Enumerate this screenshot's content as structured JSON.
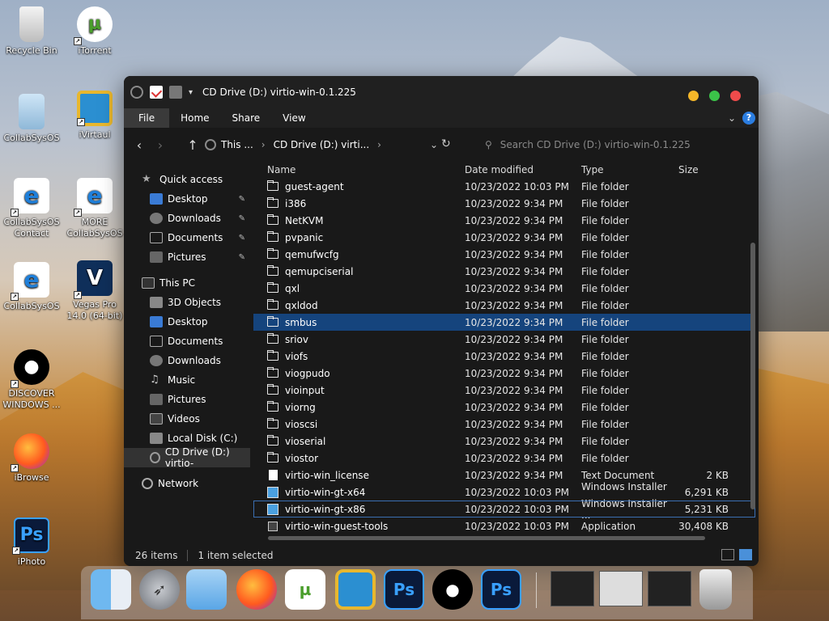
{
  "desktop": {
    "icons": [
      {
        "label": "Recycle Bin",
        "icon": "recycle-bin-icon"
      },
      {
        "label": "iTorrent",
        "icon": "utorrent-icon"
      },
      {
        "label": "CollabSysOS",
        "icon": "folder-icon"
      },
      {
        "label": "iVirtaul",
        "icon": "virtual-icon"
      },
      {
        "label": "CollabSysOS Contact",
        "icon": "ie-icon"
      },
      {
        "label": "MORE CollabSysOS",
        "icon": "ie-icon"
      },
      {
        "label": "CollabSysOS",
        "icon": "ie-icon"
      },
      {
        "label": "Vegas Pro 14.0 (64-bit)",
        "icon": "vegas-icon"
      },
      {
        "label": "DISCOVER WINDOWS ...",
        "icon": "apple-icon"
      },
      {
        "label": "iBrowse",
        "icon": "firefox-icon"
      },
      {
        "label": "iPhoto",
        "icon": "photoshop-icon"
      }
    ]
  },
  "window": {
    "title": "CD Drive (D:) virtio-win-0.1.225",
    "ribbon_tabs": [
      "File",
      "Home",
      "Share",
      "View"
    ],
    "help_label": "?",
    "address": {
      "crumbs": [
        "This ...",
        "CD Drive (D:) virti..."
      ],
      "search_placeholder": "Search CD Drive (D:) virtio-win-0.1.225"
    },
    "nav": {
      "quick_access": "Quick access",
      "quick_items": [
        "Desktop",
        "Downloads",
        "Documents",
        "Pictures"
      ],
      "this_pc": "This PC",
      "pc_items": [
        "3D Objects",
        "Desktop",
        "Documents",
        "Downloads",
        "Music",
        "Pictures",
        "Videos",
        "Local Disk (C:)",
        "CD Drive (D:) virtio-"
      ],
      "network": "Network"
    },
    "columns": {
      "name": "Name",
      "date": "Date modified",
      "type": "Type",
      "size": "Size"
    },
    "rows": [
      {
        "name": "guest-agent",
        "date": "10/23/2022 10:03 PM",
        "type": "File folder",
        "size": "",
        "kind": "folder"
      },
      {
        "name": "i386",
        "date": "10/23/2022 9:34 PM",
        "type": "File folder",
        "size": "",
        "kind": "folder"
      },
      {
        "name": "NetKVM",
        "date": "10/23/2022 9:34 PM",
        "type": "File folder",
        "size": "",
        "kind": "folder"
      },
      {
        "name": "pvpanic",
        "date": "10/23/2022 9:34 PM",
        "type": "File folder",
        "size": "",
        "kind": "folder"
      },
      {
        "name": "qemufwcfg",
        "date": "10/23/2022 9:34 PM",
        "type": "File folder",
        "size": "",
        "kind": "folder"
      },
      {
        "name": "qemupciserial",
        "date": "10/23/2022 9:34 PM",
        "type": "File folder",
        "size": "",
        "kind": "folder"
      },
      {
        "name": "qxl",
        "date": "10/23/2022 9:34 PM",
        "type": "File folder",
        "size": "",
        "kind": "folder"
      },
      {
        "name": "qxldod",
        "date": "10/23/2022 9:34 PM",
        "type": "File folder",
        "size": "",
        "kind": "folder"
      },
      {
        "name": "smbus",
        "date": "10/23/2022 9:34 PM",
        "type": "File folder",
        "size": "",
        "kind": "folder"
      },
      {
        "name": "sriov",
        "date": "10/23/2022 9:34 PM",
        "type": "File folder",
        "size": "",
        "kind": "folder"
      },
      {
        "name": "viofs",
        "date": "10/23/2022 9:34 PM",
        "type": "File folder",
        "size": "",
        "kind": "folder"
      },
      {
        "name": "viogpudo",
        "date": "10/23/2022 9:34 PM",
        "type": "File folder",
        "size": "",
        "kind": "folder"
      },
      {
        "name": "vioinput",
        "date": "10/23/2022 9:34 PM",
        "type": "File folder",
        "size": "",
        "kind": "folder"
      },
      {
        "name": "viorng",
        "date": "10/23/2022 9:34 PM",
        "type": "File folder",
        "size": "",
        "kind": "folder"
      },
      {
        "name": "vioscsi",
        "date": "10/23/2022 9:34 PM",
        "type": "File folder",
        "size": "",
        "kind": "folder"
      },
      {
        "name": "vioserial",
        "date": "10/23/2022 9:34 PM",
        "type": "File folder",
        "size": "",
        "kind": "folder"
      },
      {
        "name": "viostor",
        "date": "10/23/2022 9:34 PM",
        "type": "File folder",
        "size": "",
        "kind": "folder"
      },
      {
        "name": "virtio-win_license",
        "date": "10/23/2022 9:34 PM",
        "type": "Text Document",
        "size": "2 KB",
        "kind": "text"
      },
      {
        "name": "virtio-win-gt-x64",
        "date": "10/23/2022 10:03 PM",
        "type": "Windows Installer ...",
        "size": "6,291 KB",
        "kind": "msi"
      },
      {
        "name": "virtio-win-gt-x86",
        "date": "10/23/2022 10:03 PM",
        "type": "Windows Installer ...",
        "size": "5,231 KB",
        "kind": "msi"
      },
      {
        "name": "virtio-win-guest-tools",
        "date": "10/23/2022 10:03 PM",
        "type": "Application",
        "size": "30,408 KB",
        "kind": "app"
      }
    ],
    "selected_row": "smbus",
    "status": {
      "items": "26 items",
      "selected": "1 item selected"
    }
  },
  "dock": {
    "apps": [
      "Finder",
      "Launchpad",
      "Folder",
      "Firefox",
      "uTorrent",
      "iVirtual",
      "Photoshop",
      "Apple",
      "Photoshop"
    ]
  },
  "colors": {
    "window_bg": "#191919",
    "selection": "#15447d",
    "accent": "#2b7de0"
  }
}
